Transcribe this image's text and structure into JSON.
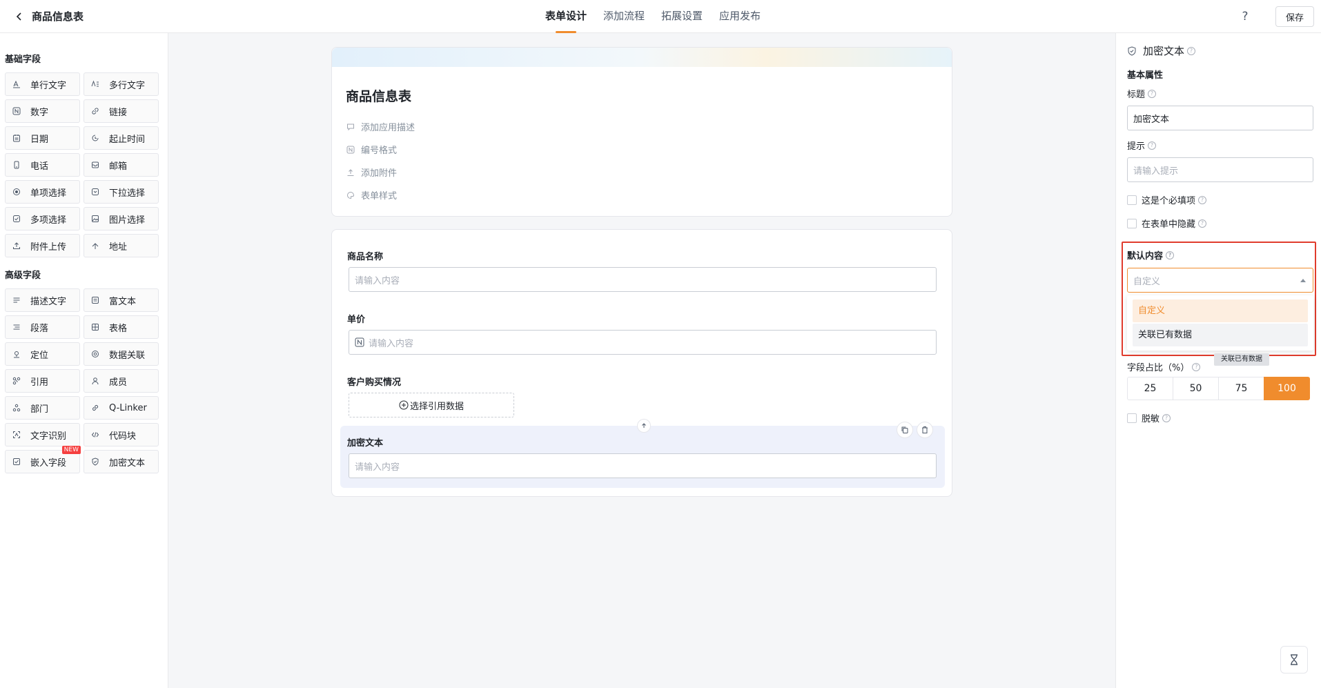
{
  "header": {
    "title": "商品信息表",
    "tabs": [
      "表单设计",
      "添加流程",
      "拓展设置",
      "应用发布"
    ],
    "help": "?",
    "save": "保存"
  },
  "left": {
    "basic_title": "基础字段",
    "basic": [
      "单行文字",
      "多行文字",
      "数字",
      "链接",
      "日期",
      "起止时间",
      "电话",
      "邮箱",
      "单项选择",
      "下拉选择",
      "多项选择",
      "图片选择",
      "附件上传",
      "地址"
    ],
    "advanced_title": "高级字段",
    "advanced": [
      "描述文字",
      "富文本",
      "段落",
      "表格",
      "定位",
      "数据关联",
      "引用",
      "成员",
      "部门",
      "Q-Linker",
      "文字识别",
      "代码块",
      "嵌入字段",
      "加密文本"
    ],
    "new_badge": "NEW"
  },
  "form": {
    "title": "商品信息表",
    "meta": [
      "添加应用描述",
      "编号格式",
      "添加附件",
      "表单样式"
    ],
    "fields": {
      "name_label": "商品名称",
      "name_ph": "请输入内容",
      "price_label": "单价",
      "price_ph": "请输入内容",
      "customer_label": "客户购买情况",
      "ref_btn": "选择引用数据",
      "encrypt_label": "加密文本",
      "encrypt_ph": "请输入内容"
    }
  },
  "props": {
    "title": "加密文本",
    "basic": "基本属性",
    "label_title": "标题",
    "title_value": "加密文本",
    "label_hint": "提示",
    "hint_ph": "请输入提示",
    "required": "这是个必填项",
    "hidden": "在表单中隐藏",
    "default_label": "默认内容",
    "default_ph": "自定义",
    "options": [
      "自定义",
      "关联已有数据"
    ],
    "tooltip": "关联已有数据",
    "ratio_label": "字段占比（%）",
    "ratios": [
      "25",
      "50",
      "75",
      "100"
    ],
    "mask": "脱敏"
  }
}
